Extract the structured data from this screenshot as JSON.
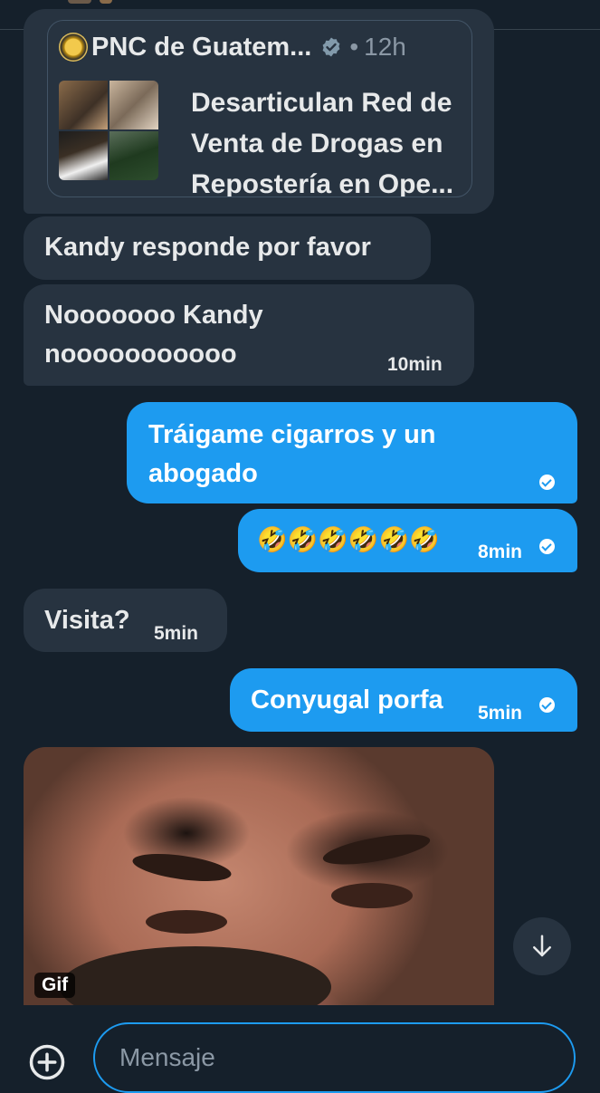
{
  "shared_post": {
    "author": "PNC de Guatem...",
    "dot": "•",
    "time": "12h",
    "title": "Desarticulan Red de Venta de Drogas en Repostería en Ope..."
  },
  "messages": [
    {
      "dir": "received",
      "text": "Kandy responde por favor",
      "time": ""
    },
    {
      "dir": "received",
      "line1": "Nooooooo Kandy",
      "line2": "nooooooooooo",
      "time": "10min"
    },
    {
      "dir": "sent",
      "line1": "Tráigame cigarros y un",
      "line2": "abogado",
      "time": ""
    },
    {
      "dir": "sent",
      "text": "🤣🤣🤣🤣🤣🤣",
      "time": "8min"
    },
    {
      "dir": "received",
      "text": "Visita?",
      "time": "5min"
    },
    {
      "dir": "sent",
      "text": "Conyugal porfa",
      "time": "5min"
    }
  ],
  "gif": {
    "badge": "Gif"
  },
  "composer": {
    "placeholder": "Mensaje"
  },
  "icons": {
    "verified": "verified-badge-icon",
    "read_receipt": "check-circle-icon",
    "scroll_down": "arrow-down-icon",
    "add_media": "plus-circle-icon"
  },
  "colors": {
    "background": "#15202b",
    "received_bubble": "#273340",
    "sent_bubble": "#1d9bf0",
    "secondary_text": "#8b98a5"
  }
}
